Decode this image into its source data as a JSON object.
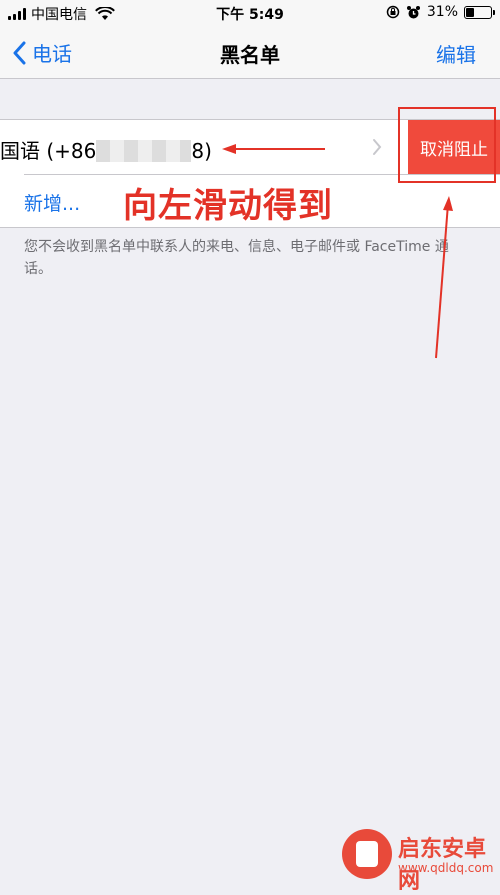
{
  "status_bar": {
    "carrier": "中国电信",
    "time": "下午 5:49",
    "battery_percent": "31%",
    "battery_level": 0.31,
    "icons": [
      "signal-icon",
      "wifi-icon",
      "rotation-lock-icon",
      "alarm-icon",
      "battery-icon"
    ]
  },
  "nav": {
    "back_label": "电话",
    "title": "黑名单",
    "edit_label": "编辑"
  },
  "list": {
    "blocked_contact_prefix": "国语 (+86",
    "blocked_contact_suffix": "8)",
    "unblock_label": "取消阻止",
    "add_new_label": "新增..."
  },
  "footer_note": "您不会收到黑名单中联系人的来电、信息、电子邮件或 FaceTime 通话。",
  "annotation": {
    "text": "向左滑动得到",
    "color": "#e33227"
  },
  "watermark": {
    "title": "启东安卓网",
    "url": "www.qdldq.com"
  },
  "colors": {
    "accent": "#1a73e8",
    "destructive": "#f04a3c",
    "background": "#efeff4"
  }
}
